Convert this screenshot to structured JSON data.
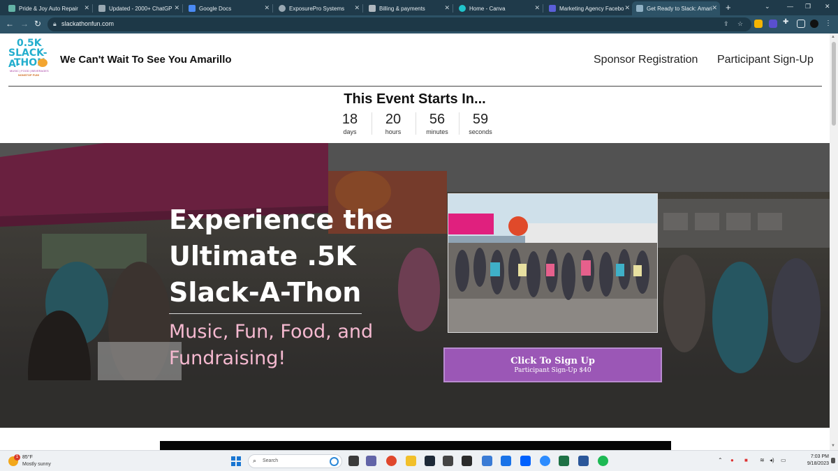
{
  "browser": {
    "tabs": [
      {
        "title": "Pride & Joy Auto Repair",
        "color": "#63b3a6"
      },
      {
        "title": "Updated - 2000+ ChatGP",
        "color": "#9aa9b3"
      },
      {
        "title": "Google Docs",
        "color": "#4a8af4"
      },
      {
        "title": "ExposurePro Systems",
        "color": "#9aa9b3"
      },
      {
        "title": "Billing & payments",
        "color": "#b0b8bf"
      },
      {
        "title": "Home - Canva",
        "color": "#20c4cb"
      },
      {
        "title": "Marketing Agency Facebo",
        "color": "#5b5fd9"
      },
      {
        "title": "Get Ready to Slack: Amari",
        "color": "#8fb0c4",
        "active": true
      }
    ],
    "url": "slackathonfun.com"
  },
  "site": {
    "logo": {
      "line1": "0.5K",
      "line2": "SLACK-A-",
      "line3": "THON",
      "tagline": "MUSIC | FOOD | BEVERAGES",
      "tagline2": "NONSTOP FUN!"
    },
    "title": "We Can't Wait To See You Amarillo",
    "nav": [
      "Sponsor Registration",
      "Participant Sign-Up"
    ]
  },
  "countdown": {
    "title": "This Event Starts In...",
    "units": [
      {
        "value": "18",
        "label": "days"
      },
      {
        "value": "20",
        "label": "hours"
      },
      {
        "value": "56",
        "label": "minutes"
      },
      {
        "value": "59",
        "label": "seconds"
      }
    ]
  },
  "hero": {
    "headline": "Experience the Ultimate .5K Slack-A-Thon",
    "subheadline": "Music, Fun, Food, and Fundraising!",
    "button_main": "Click To Sign Up",
    "button_sub": "Participant Sign-Up $40",
    "colors": {
      "subheadline": "#f5b9d0",
      "button": "#9b57b6"
    }
  },
  "taskbar": {
    "weather_temp": "85°F",
    "weather_condition": "Mostly sunny",
    "weather_badge": "1",
    "search_placeholder": "Search",
    "time": "7:03 PM",
    "date": "9/18/2023"
  }
}
